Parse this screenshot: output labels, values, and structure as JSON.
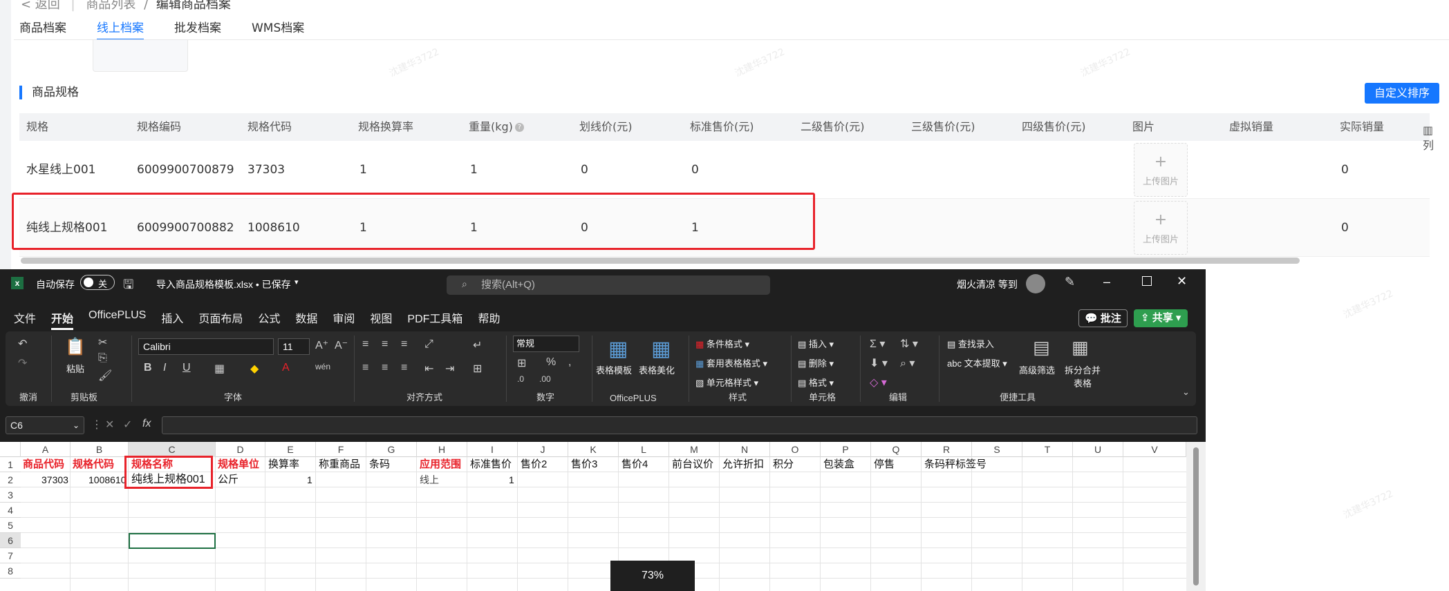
{
  "crumb": {
    "back": "< 返回",
    "sep": "|",
    "list": "商品列表",
    "slash": "/",
    "edit": "编辑商品档案"
  },
  "tabs": [
    "商品档案",
    "线上档案",
    "批发档案",
    "WMS档案"
  ],
  "section_title": "商品规格",
  "custom_sort_button": "自定义排序",
  "col_settings": "列",
  "table": {
    "headers": [
      "规格",
      "规格编码",
      "规格代码",
      "规格换算率",
      "重量(kg)",
      "划线价(元)",
      "标准售价(元)",
      "二级售价(元)",
      "三级售价(元)",
      "四级售价(元)",
      "图片",
      "虚拟销量",
      "实际销量"
    ],
    "rows": [
      {
        "spec": "水星线上001",
        "code": "6009900700879",
        "spec_code": "37303",
        "rate": "1",
        "weight": "1",
        "line_price": "0",
        "std_price": "0",
        "actual_sales": "0"
      },
      {
        "spec": "纯线上规格001",
        "code": "6009900700882",
        "spec_code": "1008610",
        "rate": "1",
        "weight": "1",
        "line_price": "0",
        "std_price": "1",
        "actual_sales": "0"
      }
    ],
    "upload_label": "上传图片"
  },
  "watermark": "沈建华3722",
  "excel": {
    "autosave_label": "自动保存",
    "autosave_state": "关",
    "filename": "导入商品规格模板.xlsx • 已保存",
    "search_placeholder": "搜索(Alt+Q)",
    "user": "烟火清凉 等到",
    "menus": [
      "文件",
      "开始",
      "OfficePLUS",
      "插入",
      "页面布局",
      "公式",
      "数据",
      "审阅",
      "视图",
      "PDF工具箱",
      "帮助"
    ],
    "comment_btn": "批注",
    "share_btn": "共享",
    "groups": [
      "撤消",
      "剪贴板",
      "字体",
      "对齐方式",
      "数字",
      "OfficePLUS",
      "样式",
      "单元格",
      "编辑",
      "便捷工具"
    ],
    "font_name": "Calibri",
    "font_size": "11",
    "number_format": "常规",
    "ribbon_labels": {
      "paste": "粘贴",
      "table_template": "表格模板",
      "table_beautify": "表格美化",
      "cond_format": "条件格式",
      "table_format": "套用表格格式",
      "cell_style": "单元格样式",
      "insert": "插入",
      "delete": "删除",
      "format": "格式",
      "find_entry": "查找录入",
      "text_extract": "文本提取",
      "adv_filter": "高级筛选",
      "split_merge": "拆分合并表格"
    },
    "namebox": "C6",
    "zoom": "73%",
    "columns": [
      "A",
      "B",
      "C",
      "D",
      "E",
      "F",
      "G",
      "H",
      "I",
      "J",
      "K",
      "L",
      "M",
      "N",
      "O",
      "P",
      "Q",
      "R",
      "S",
      "T",
      "U",
      "V"
    ],
    "rows_nums": [
      "1",
      "2",
      "3",
      "4",
      "5",
      "6",
      "7",
      "8"
    ],
    "row1": [
      "商品代码",
      "规格代码",
      "规格名称",
      "规格单位",
      "换算率",
      "称重商品",
      "条码",
      "应用范围",
      "标准售价",
      "售价2",
      "售价3",
      "售价4",
      "前台议价",
      "允许折扣",
      "积分",
      "包装盒",
      "停售",
      "条码秤标签号"
    ],
    "row2": {
      "A": "37303",
      "B": "1008610",
      "C": "纯线上规格001",
      "D": "公斤",
      "E": "1",
      "H": "线上",
      "I": "1"
    }
  }
}
